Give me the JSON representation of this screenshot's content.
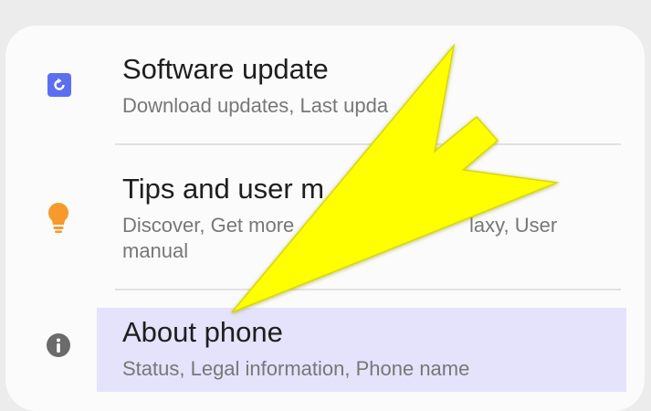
{
  "settings": {
    "items": [
      {
        "title": "Software update",
        "subtitle": "Download updates, Last upda",
        "icon": "software-update-icon"
      },
      {
        "title": "Tips and user m",
        "subtitle_start": "Discover, Get more",
        "subtitle_end": "laxy, User",
        "subtitle_line2": "manual",
        "icon": "lightbulb-icon"
      },
      {
        "title": "About phone",
        "subtitle": "Status, Legal information, Phone name",
        "icon": "info-icon",
        "highlighted": true
      }
    ]
  },
  "colors": {
    "update_icon": "#5d6ff0",
    "tips_icon": "#f79a2b",
    "info_icon": "#6b6b6b",
    "highlight": "#e5e2fb",
    "arrow_fill": "#ffff00"
  },
  "overlay": {
    "icon": "yellow-arrow-annotation"
  }
}
